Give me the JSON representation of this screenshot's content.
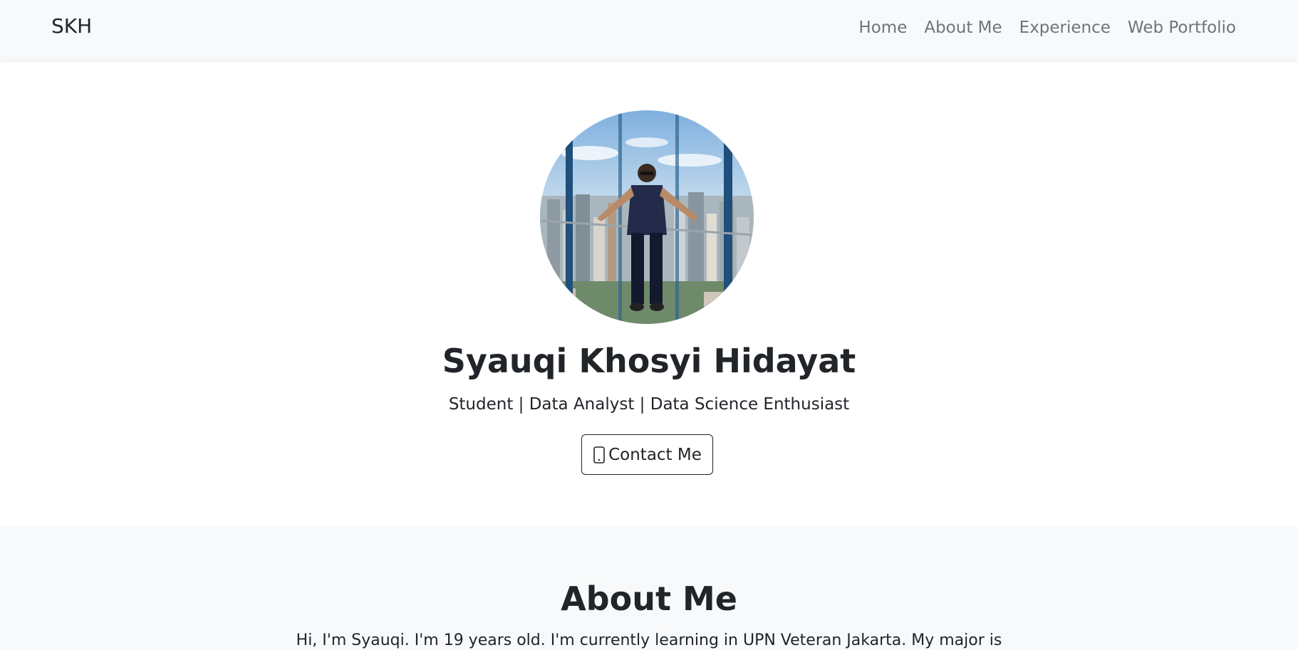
{
  "navbar": {
    "brand": "SKH",
    "links": [
      "Home",
      "About Me",
      "Experience",
      "Web Portfolio"
    ]
  },
  "hero": {
    "name": "Syauqi Khosyi Hidayat",
    "tagline": "Student | Data Analyst | Data Science Enthusiast",
    "contact_label": "Contact Me",
    "contact_icon": "phone-icon"
  },
  "about": {
    "title": "About Me",
    "text": "Hi, I'm Syauqi. I'm 19 years old. I'm currently learning in UPN Veteran Jakarta. My major is"
  },
  "colors": {
    "navbar_bg": "#f8f9fa",
    "nav_link": "#6c757d",
    "text": "#212529",
    "section_alt_bg": "#f8f9fa"
  }
}
